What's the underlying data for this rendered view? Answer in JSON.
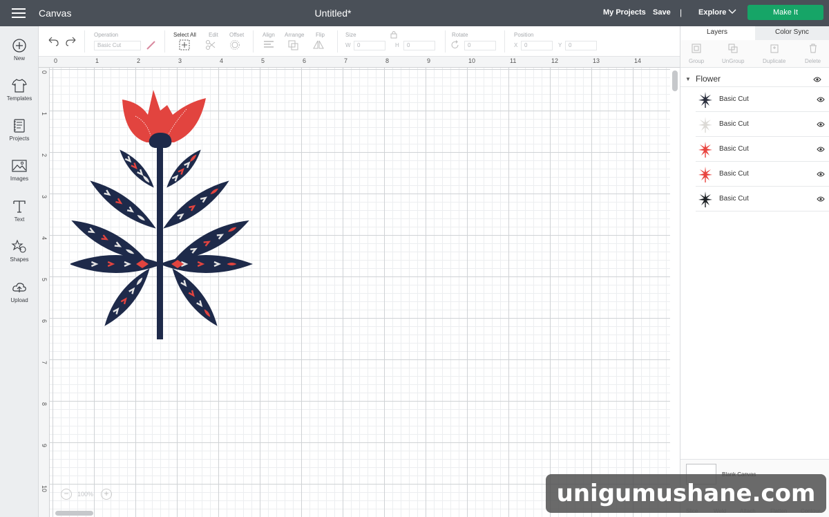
{
  "header": {
    "app_title": "Canvas",
    "doc_title": "Untitled*",
    "my_projects": "My Projects",
    "save": "Save",
    "separator": "|",
    "explore": "Explore",
    "make_it": "Make It",
    "make_it_color": "#16a567"
  },
  "sidebar": {
    "items": [
      {
        "label": "New",
        "icon": "plus-circle-icon"
      },
      {
        "label": "Templates",
        "icon": "tshirt-icon"
      },
      {
        "label": "Projects",
        "icon": "notebook-icon"
      },
      {
        "label": "Images",
        "icon": "image-icon"
      },
      {
        "label": "Text",
        "icon": "text-icon"
      },
      {
        "label": "Shapes",
        "icon": "shapes-icon"
      },
      {
        "label": "Upload",
        "icon": "upload-icon"
      }
    ]
  },
  "toolbar": {
    "operation_label": "Operation",
    "operation_value": "Basic Cut",
    "select_all": "Select All",
    "edit": "Edit",
    "offset": "Offset",
    "align": "Align",
    "arrange": "Arrange",
    "flip": "Flip",
    "size": "Size",
    "w_label": "W",
    "w_value": "0",
    "h_label": "H",
    "h_value": "0",
    "rotate": "Rotate",
    "rotate_value": "0",
    "position": "Position",
    "x_label": "X",
    "x_value": "0",
    "y_label": "Y",
    "y_value": "0"
  },
  "rulers": {
    "top": [
      "0",
      "1",
      "2",
      "3",
      "4",
      "5",
      "6",
      "7",
      "8",
      "9",
      "10",
      "11",
      "12",
      "13",
      "14"
    ],
    "left": [
      "0",
      "1",
      "2",
      "3",
      "4",
      "5",
      "6",
      "7",
      "8",
      "9",
      "10"
    ]
  },
  "zoom": {
    "minus": "−",
    "value": "100%",
    "plus": "+"
  },
  "layers_panel": {
    "tabs": [
      "Layers",
      "Color Sync"
    ],
    "actions": [
      "Group",
      "UnGroup",
      "Duplicate",
      "Delete"
    ],
    "group_name": "Flower",
    "layers": [
      {
        "name": "Basic Cut",
        "color": "#2b2f3d"
      },
      {
        "name": "Basic Cut",
        "color": "#dcdad6"
      },
      {
        "name": "Basic Cut",
        "color": "#e8443f"
      },
      {
        "name": "Basic Cut",
        "color": "#e8443f"
      },
      {
        "name": "Basic Cut",
        "color": "#1f2326"
      }
    ],
    "blank_canvas": "Blank Canvas",
    "bottom_tools": [
      "Slice",
      "Weld",
      "Attach",
      "Flatten",
      "Contour"
    ]
  },
  "artwork": {
    "navy": "#1e2a4a",
    "red": "#e2443f",
    "light": "#e4e4e4"
  },
  "watermark": "unigumushane.com"
}
